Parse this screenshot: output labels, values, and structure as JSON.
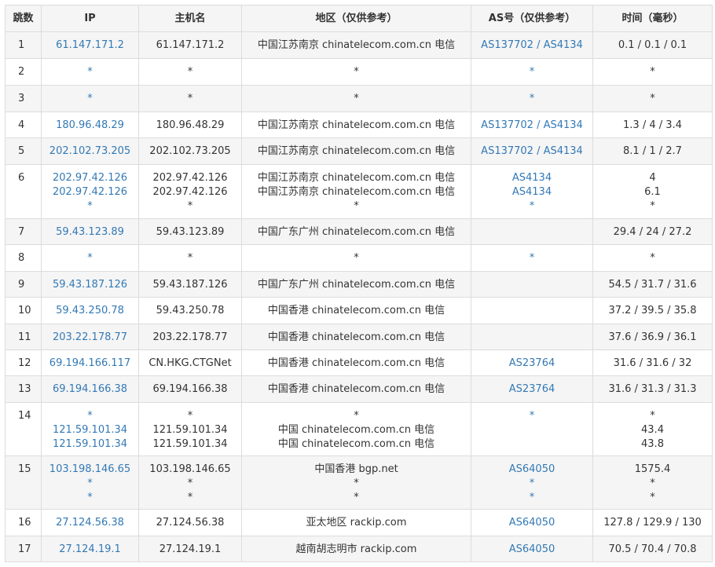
{
  "headers": [
    "跳数",
    "IP",
    "主机名",
    "地区（仅供参考）",
    "AS号（仅供参考）",
    "时间（毫秒）"
  ],
  "rows": [
    {
      "hop": "1",
      "ip": [
        "61.147.171.2"
      ],
      "host": [
        "61.147.171.2"
      ],
      "region": [
        "中国江苏南京 chinatelecom.com.cn 电信"
      ],
      "as": [
        "AS137702 / AS4134"
      ],
      "time": [
        "0.1 / 0.1 / 0.1"
      ]
    },
    {
      "hop": "2",
      "ip": [
        "*"
      ],
      "host": [
        "*"
      ],
      "region": [
        "*"
      ],
      "as": [
        "*"
      ],
      "time": [
        "*"
      ]
    },
    {
      "hop": "3",
      "ip": [
        "*"
      ],
      "host": [
        "*"
      ],
      "region": [
        "*"
      ],
      "as": [
        "*"
      ],
      "time": [
        "*"
      ]
    },
    {
      "hop": "4",
      "ip": [
        "180.96.48.29"
      ],
      "host": [
        "180.96.48.29"
      ],
      "region": [
        "中国江苏南京 chinatelecom.com.cn 电信"
      ],
      "as": [
        "AS137702 / AS4134"
      ],
      "time": [
        "1.3 / 4 / 3.4"
      ]
    },
    {
      "hop": "5",
      "ip": [
        "202.102.73.205"
      ],
      "host": [
        "202.102.73.205"
      ],
      "region": [
        "中国江苏南京 chinatelecom.com.cn 电信"
      ],
      "as": [
        "AS137702 / AS4134"
      ],
      "time": [
        "8.1 / 1 / 2.7"
      ]
    },
    {
      "hop": "6",
      "ip": [
        "202.97.42.126",
        "202.97.42.126",
        "*"
      ],
      "host": [
        "202.97.42.126",
        "202.97.42.126",
        "*"
      ],
      "region": [
        "中国江苏南京 chinatelecom.com.cn 电信",
        "中国江苏南京 chinatelecom.com.cn 电信",
        "*"
      ],
      "as": [
        "AS4134",
        "AS4134",
        "*"
      ],
      "time": [
        "4",
        "6.1",
        "*"
      ]
    },
    {
      "hop": "7",
      "ip": [
        "59.43.123.89"
      ],
      "host": [
        "59.43.123.89"
      ],
      "region": [
        "中国广东广州 chinatelecom.com.cn 电信"
      ],
      "as": [
        ""
      ],
      "time": [
        "29.4 / 24 / 27.2"
      ]
    },
    {
      "hop": "8",
      "ip": [
        "*"
      ],
      "host": [
        "*"
      ],
      "region": [
        "*"
      ],
      "as": [
        "*"
      ],
      "time": [
        "*"
      ]
    },
    {
      "hop": "9",
      "ip": [
        "59.43.187.126"
      ],
      "host": [
        "59.43.187.126"
      ],
      "region": [
        "中国广东广州 chinatelecom.com.cn 电信"
      ],
      "as": [
        ""
      ],
      "time": [
        "54.5 / 31.7 / 31.6"
      ]
    },
    {
      "hop": "10",
      "ip": [
        "59.43.250.78"
      ],
      "host": [
        "59.43.250.78"
      ],
      "region": [
        "中国香港 chinatelecom.com.cn 电信"
      ],
      "as": [
        ""
      ],
      "time": [
        "37.2 / 39.5 / 35.8"
      ]
    },
    {
      "hop": "11",
      "ip": [
        "203.22.178.77"
      ],
      "host": [
        "203.22.178.77"
      ],
      "region": [
        "中国香港 chinatelecom.com.cn 电信"
      ],
      "as": [
        ""
      ],
      "time": [
        "37.6 / 36.9 / 36.1"
      ]
    },
    {
      "hop": "12",
      "ip": [
        "69.194.166.117"
      ],
      "host": [
        "CN.HKG.CTGNet"
      ],
      "region": [
        "中国香港 chinatelecom.com.cn 电信"
      ],
      "as": [
        "AS23764"
      ],
      "time": [
        "31.6 / 31.6 / 32"
      ]
    },
    {
      "hop": "13",
      "ip": [
        "69.194.166.38"
      ],
      "host": [
        "69.194.166.38"
      ],
      "region": [
        "中国香港 chinatelecom.com.cn 电信"
      ],
      "as": [
        "AS23764"
      ],
      "time": [
        "31.6 / 31.3 / 31.3"
      ]
    },
    {
      "hop": "14",
      "ip": [
        "*",
        "121.59.101.34",
        "121.59.101.34"
      ],
      "host": [
        "*",
        "121.59.101.34",
        "121.59.101.34"
      ],
      "region": [
        "*",
        "中国 chinatelecom.com.cn 电信",
        "中国 chinatelecom.com.cn 电信"
      ],
      "as": [
        "*",
        "",
        ""
      ],
      "time": [
        "*",
        "43.4",
        "43.8"
      ]
    },
    {
      "hop": "15",
      "ip": [
        "103.198.146.65",
        "*",
        "*"
      ],
      "host": [
        "103.198.146.65",
        "*",
        "*"
      ],
      "region": [
        "中国香港 bgp.net",
        "*",
        "*"
      ],
      "as": [
        "AS64050",
        "*",
        "*"
      ],
      "time": [
        "1575.4",
        "*",
        "*"
      ]
    },
    {
      "hop": "16",
      "ip": [
        "27.124.56.38"
      ],
      "host": [
        "27.124.56.38"
      ],
      "region": [
        "亚太地区 rackip.com"
      ],
      "as": [
        "AS64050"
      ],
      "time": [
        "127.8 / 129.9 / 130"
      ]
    },
    {
      "hop": "17",
      "ip": [
        "27.124.19.1"
      ],
      "host": [
        "27.124.19.1"
      ],
      "region": [
        "越南胡志明市 rackip.com"
      ],
      "as": [
        "AS64050"
      ],
      "time": [
        "70.5 / 70.4 / 70.8"
      ]
    }
  ]
}
